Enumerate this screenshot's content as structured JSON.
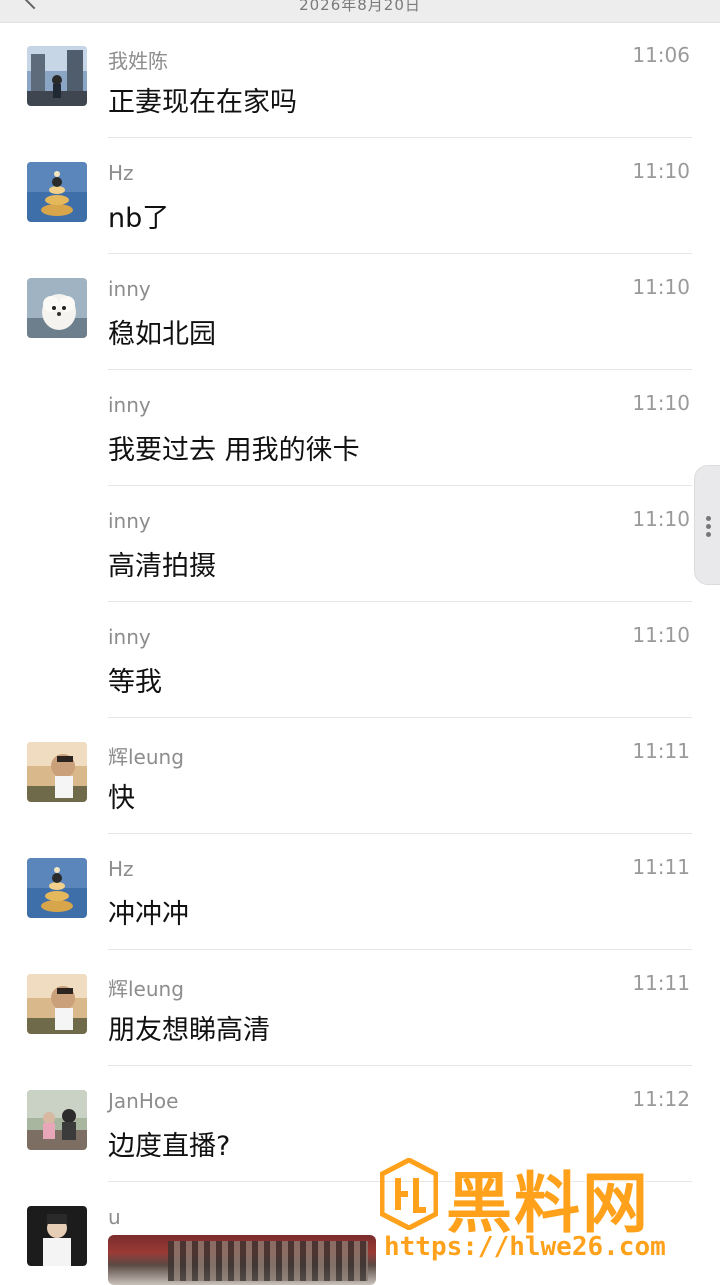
{
  "header": {
    "date": "2026年8月20日"
  },
  "messages": [
    {
      "name": "我姓陈",
      "time": "11:06",
      "text": "正妻现在在家吗",
      "avatar": "city-street-avatar"
    },
    {
      "name": "Hz",
      "time": "11:10",
      "text": "nb了",
      "avatar": "cake-avatar"
    },
    {
      "name": "inny",
      "time": "11:10",
      "text": "稳如北园",
      "avatar": "white-dog-avatar"
    },
    {
      "name": "inny",
      "time": "11:10",
      "text": "我要过去 用我的徕卡",
      "avatar": ""
    },
    {
      "name": "inny",
      "time": "11:10",
      "text": "高清拍摄",
      "avatar": ""
    },
    {
      "name": "inny",
      "time": "11:10",
      "text": "等我",
      "avatar": ""
    },
    {
      "name": "辉leung",
      "time": "11:11",
      "text": "快",
      "avatar": "person-sunset-avatar"
    },
    {
      "name": "Hz",
      "time": "11:11",
      "text": "冲冲冲",
      "avatar": "cake-avatar"
    },
    {
      "name": "辉leung",
      "time": "11:11",
      "text": "朋友想睇高清",
      "avatar": "person-sunset-avatar"
    },
    {
      "name": "JanHoe",
      "time": "11:12",
      "text": "边度直播?",
      "avatar": "kids-avatar"
    },
    {
      "name": "u",
      "time": "",
      "text": "",
      "avatar": "person-avatar"
    }
  ],
  "watermark": {
    "title": "黑料网",
    "url": "https://hlwe26.com",
    "color": "#ffa11a"
  }
}
